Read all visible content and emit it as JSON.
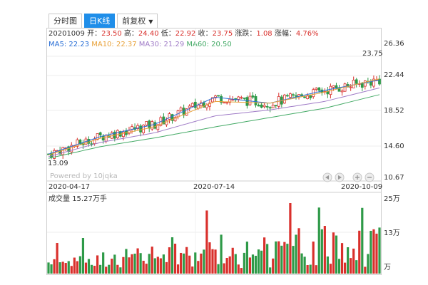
{
  "tabs": [
    {
      "label": "分时图",
      "active": false
    },
    {
      "label": "日K线",
      "active": true
    },
    {
      "label": "前复权",
      "active": false,
      "dropdown": true
    }
  ],
  "info": {
    "date": "20201009",
    "open_label": "开：",
    "open": "23.50",
    "high_label": "高：",
    "high": "24.40",
    "low_label": "低：",
    "low": "22.92",
    "close_label": "收：",
    "close": "23.75",
    "change_label": "涨跌：",
    "change": "1.08",
    "pct_label": "涨幅：",
    "pct": "4.76%"
  },
  "ma": [
    {
      "label": "MA5:",
      "value": "22.23",
      "color": "#2a6fd6"
    },
    {
      "label": "MA10:",
      "value": "22.37",
      "color": "#e8a23a"
    },
    {
      "label": "MA30:",
      "value": "21.29",
      "color": "#a07cc7"
    },
    {
      "label": "MA60:",
      "value": "20.50",
      "color": "#44aa66"
    }
  ],
  "price_axis": [
    "26.36",
    "22.44",
    "18.52",
    "14.60",
    "10.67"
  ],
  "max_price_label": "23.75",
  "min_price_label": "13.09",
  "date_axis": [
    "2020-04-17",
    "2020-07-14",
    "2020-10-09"
  ],
  "watermark": "Powered by 10jqka",
  "volume": {
    "label": "成交量",
    "value": "15.27万手",
    "axis": [
      "25万",
      "13万",
      "万"
    ]
  },
  "colors": {
    "up": "#d9302c",
    "down": "#2e9a48",
    "accent": "#1f8ee9"
  },
  "chart_data": {
    "type": "candlestick",
    "ylim": [
      10.67,
      26.36
    ],
    "xlim_dates": [
      "2020-04-17",
      "2020-10-09"
    ],
    "series": [
      {
        "name": "MA5",
        "x": [
          "2020-04-17",
          "2020-05-15",
          "2020-06-12",
          "2020-07-14",
          "2020-08-12",
          "2020-09-10",
          "2020-10-09"
        ],
        "y": [
          13.5,
          15.6,
          17.0,
          20.2,
          19.5,
          21.0,
          22.23
        ]
      },
      {
        "name": "MA10",
        "x": [
          "2020-04-17",
          "2020-05-15",
          "2020-06-12",
          "2020-07-14",
          "2020-08-12",
          "2020-09-10",
          "2020-10-09"
        ],
        "y": [
          13.4,
          15.4,
          16.7,
          19.7,
          19.5,
          20.8,
          22.37
        ]
      },
      {
        "name": "MA30",
        "x": [
          "2020-04-17",
          "2020-05-15",
          "2020-06-12",
          "2020-07-14",
          "2020-08-12",
          "2020-09-10",
          "2020-10-09"
        ],
        "y": [
          13.2,
          14.9,
          16.0,
          18.0,
          18.7,
          19.7,
          21.29
        ]
      },
      {
        "name": "MA60",
        "x": [
          "2020-04-17",
          "2020-05-15",
          "2020-06-12",
          "2020-07-14",
          "2020-08-12",
          "2020-09-10",
          "2020-10-09"
        ],
        "y": [
          13.0,
          14.4,
          15.4,
          16.7,
          17.8,
          18.9,
          20.5
        ]
      }
    ]
  }
}
